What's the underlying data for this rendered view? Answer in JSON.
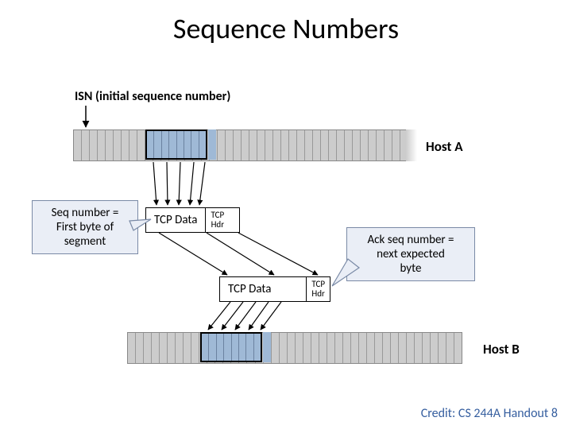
{
  "title": "Sequence Numbers",
  "isn_label": "ISN (initial sequence number)",
  "hostA": "Host A",
  "hostB": "Host B",
  "seg1": {
    "data": "TCP Data",
    "hdr1": "TCP",
    "hdr2": "Hdr"
  },
  "seg2": {
    "data": "TCP Data",
    "hdr1": "TCP",
    "hdr2": "Hdr"
  },
  "call_seq_l1": "Seq number =",
  "call_seq_l2": "First byte of",
  "call_seq_l3": "segment",
  "call_ack_l1": "Ack seq number =",
  "call_ack_l2": "next expected",
  "call_ack_l3": "byte",
  "credit": "Credit: CS 244A Handout 8"
}
